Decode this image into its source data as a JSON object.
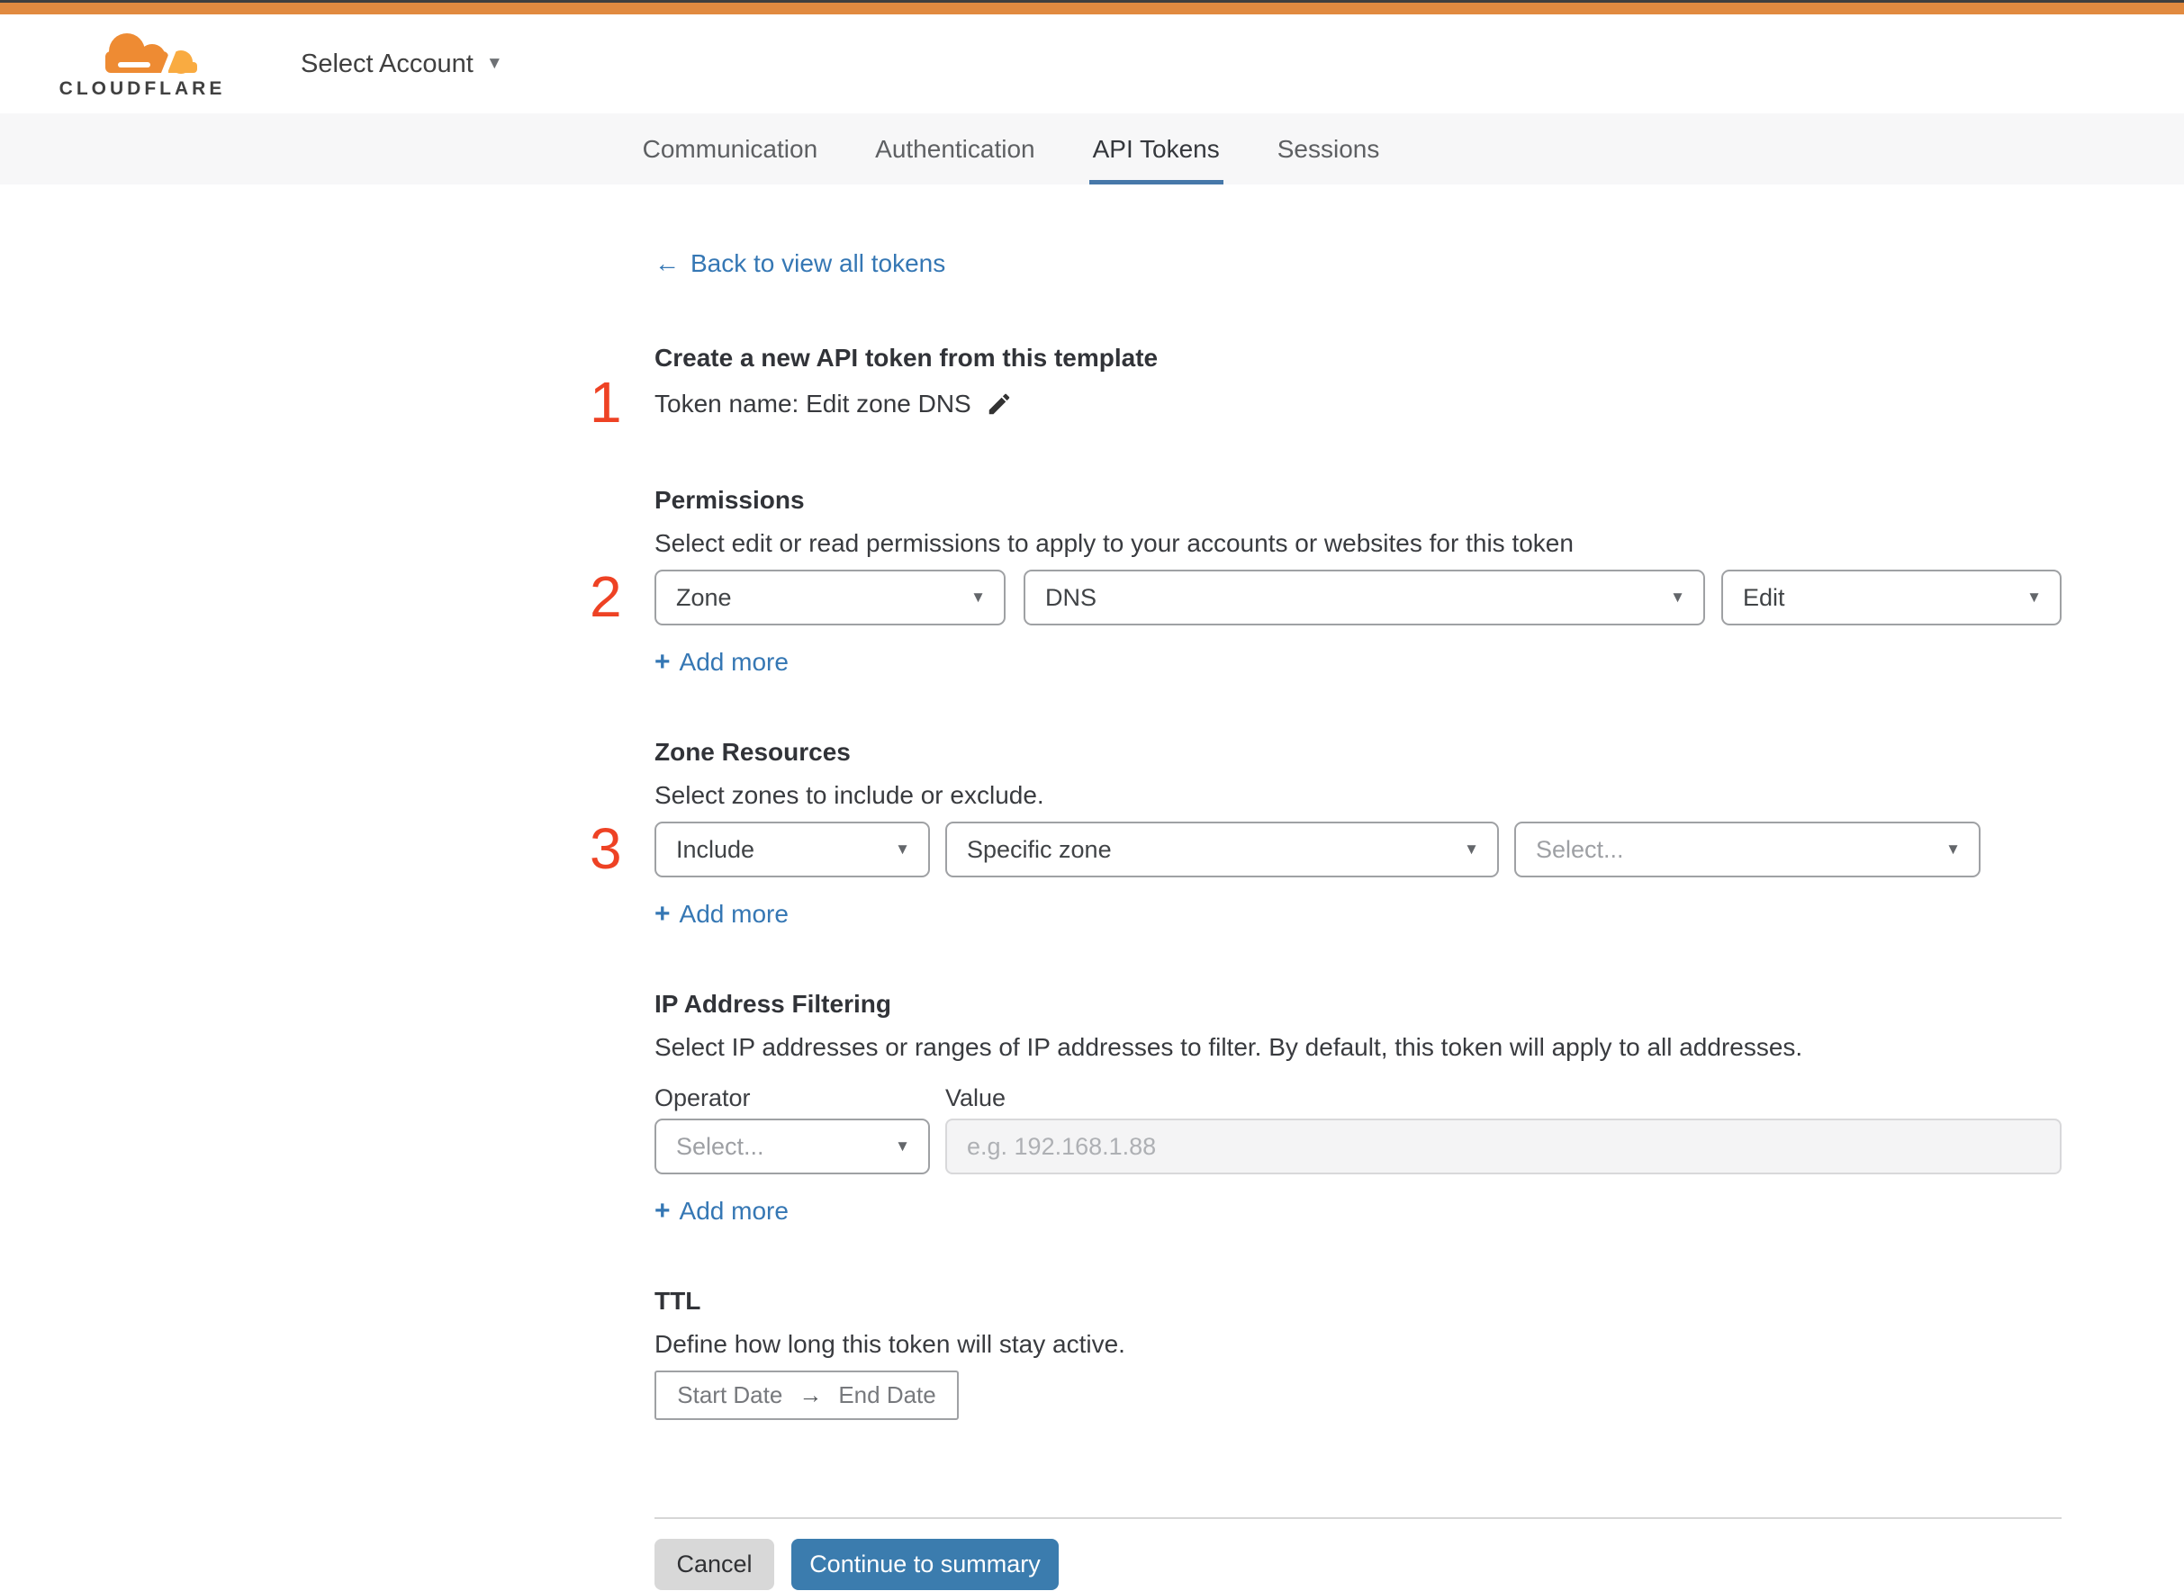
{
  "colors": {
    "top_line": "#3F3F3F",
    "brand_orange": "#E18A40",
    "logo_orange": "#EE8B33",
    "logo_light_orange": "#F9AB41",
    "accent_blue": "#3577B4",
    "button_blue": "#3B7CAE",
    "tab_underline": "#4778A9",
    "step_red": "#EE4224"
  },
  "icons": {
    "back_arrow": "←",
    "caret_down": "▼",
    "plus": "+",
    "range_arrow": "→",
    "pencil": "edit-pencil"
  },
  "header": {
    "logo_text": "CLOUDFLARE",
    "account_selector_label": "Select Account"
  },
  "tabs": [
    {
      "label": "Communication",
      "active": false
    },
    {
      "label": "Authentication",
      "active": false
    },
    {
      "label": "API Tokens",
      "active": true
    },
    {
      "label": "Sessions",
      "active": false
    }
  ],
  "back_link": {
    "label": "Back to view all tokens"
  },
  "template_section": {
    "step": "1",
    "heading": "Create a new API token from this template",
    "token_name": "Token name: Edit zone DNS"
  },
  "permissions": {
    "step": "2",
    "heading": "Permissions",
    "subtitle": "Select edit or read permissions to apply to your accounts or websites for this token",
    "selects": [
      {
        "value": "Zone"
      },
      {
        "value": "DNS"
      },
      {
        "value": "Edit"
      }
    ],
    "add_more_label": "Add more"
  },
  "zone_resources": {
    "step": "3",
    "heading": "Zone Resources",
    "subtitle": "Select zones to include or exclude.",
    "selects": [
      {
        "value": "Include"
      },
      {
        "value": "Specific zone"
      },
      {
        "value": "Select..."
      }
    ],
    "add_more_label": "Add more"
  },
  "ip_filtering": {
    "heading": "IP Address Filtering",
    "subtitle": "Select IP addresses or ranges of IP addresses to filter. By default, this token will apply to all addresses.",
    "operator_label": "Operator",
    "value_label": "Value",
    "operator_select_value": "Select...",
    "value_current": "",
    "value_placeholder": "e.g. 192.168.1.88",
    "add_more_label": "Add more"
  },
  "ttl": {
    "heading": "TTL",
    "subtitle": "Define how long this token will stay active.",
    "start_label": "Start Date",
    "end_label": "End Date"
  },
  "footer": {
    "cancel_label": "Cancel",
    "continue_label": "Continue to summary"
  }
}
